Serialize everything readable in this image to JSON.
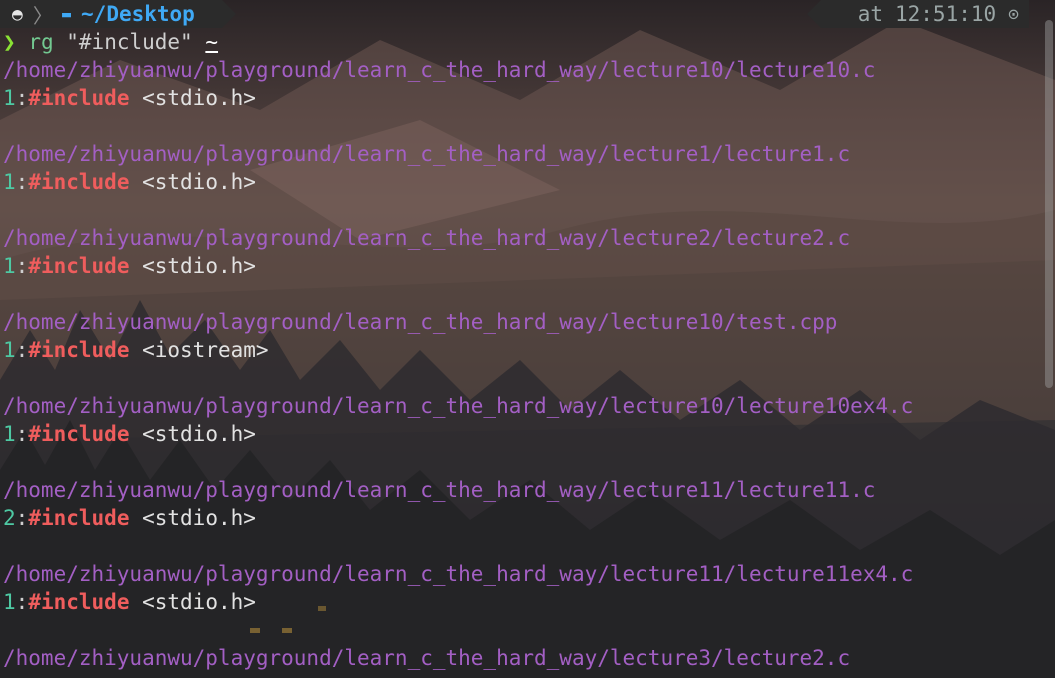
{
  "prompt": {
    "os_icon": "linux-penguin-icon",
    "separator_icon": "chevron-right-icon",
    "folder_icon": "folder-icon",
    "path": "~/Desktop",
    "at_label": "at",
    "time": "12:51:10",
    "clock_icon": "clock-icon"
  },
  "command": {
    "arrow": "❯",
    "name": "rg",
    "argument": "\"#include\"",
    "target": "~"
  },
  "results": [
    {
      "file": "/home/zhiyuanwu/playground/learn_c_the_hard_way/lecture10/lecture10.c",
      "line_no": "1",
      "match": "#include",
      "rest": " <stdio.h>"
    },
    {
      "file": "/home/zhiyuanwu/playground/learn_c_the_hard_way/lecture1/lecture1.c",
      "line_no": "1",
      "match": "#include",
      "rest": " <stdio.h>"
    },
    {
      "file": "/home/zhiyuanwu/playground/learn_c_the_hard_way/lecture2/lecture2.c",
      "line_no": "1",
      "match": "#include",
      "rest": " <stdio.h>"
    },
    {
      "file": "/home/zhiyuanwu/playground/learn_c_the_hard_way/lecture10/test.cpp",
      "line_no": "1",
      "match": "#include",
      "rest": " <iostream>"
    },
    {
      "file": "/home/zhiyuanwu/playground/learn_c_the_hard_way/lecture10/lecture10ex4.c",
      "line_no": "1",
      "match": "#include",
      "rest": " <stdio.h>"
    },
    {
      "file": "/home/zhiyuanwu/playground/learn_c_the_hard_way/lecture11/lecture11.c",
      "line_no": "2",
      "match": "#include",
      "rest": " <stdio.h>"
    },
    {
      "file": "/home/zhiyuanwu/playground/learn_c_the_hard_way/lecture11/lecture11ex4.c",
      "line_no": "1",
      "match": "#include",
      "rest": " <stdio.h>"
    },
    {
      "file": "/home/zhiyuanwu/playground/learn_c_the_hard_way/lecture3/lecture2.c"
    }
  ],
  "colors": {
    "path": "#3fa9f5",
    "filename": "#a35fc4",
    "line_number": "#4ec9a3",
    "match": "#ef5d5d",
    "prompt_arrow": "#8ae234"
  }
}
